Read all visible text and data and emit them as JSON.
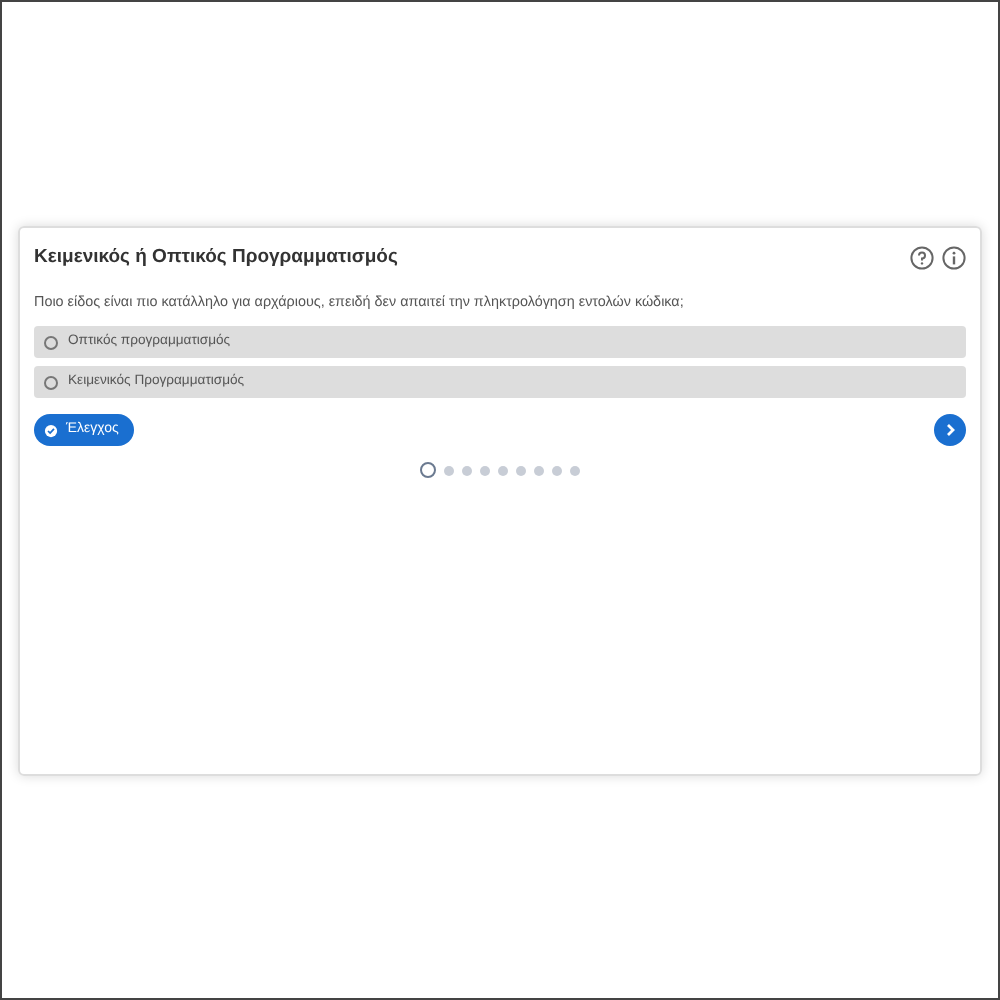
{
  "title": "Κειμενικός ή Οπτικός Προγραμματισμός",
  "question": "Ποιο είδος είναι πιο κατάλληλο για αρχάριους, επειδή δεν απαιτεί την πληκτρολόγηση εντολών κώδικα;",
  "options": [
    {
      "label": "Οπτικός προγραμματισμός",
      "selected": false
    },
    {
      "label": "Κειμενικός Προγραμματισμός",
      "selected": false
    }
  ],
  "check_button": "Έλεγχος",
  "pages": [
    {
      "selected": true
    },
    {
      "selected": false
    },
    {
      "selected": false
    },
    {
      "selected": false
    },
    {
      "selected": false
    },
    {
      "selected": false
    },
    {
      "selected": false
    },
    {
      "selected": false
    },
    {
      "selected": false
    }
  ]
}
